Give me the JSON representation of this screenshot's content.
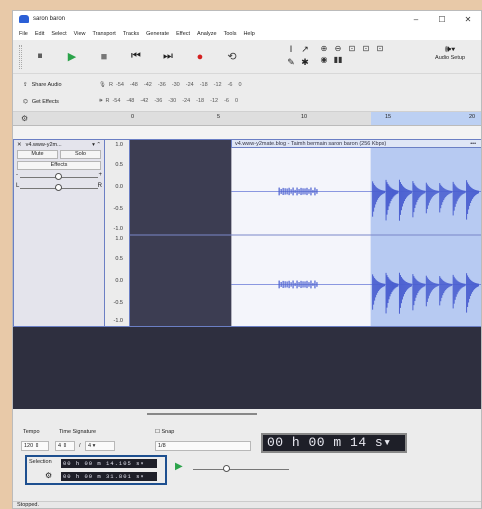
{
  "window": {
    "title": "saron baron",
    "minimize": "–",
    "maximize": "☐",
    "close": "✕"
  },
  "menu": [
    "File",
    "Edit",
    "Select",
    "View",
    "Transport",
    "Tracks",
    "Generate",
    "Effect",
    "Analyze",
    "Tools",
    "Help"
  ],
  "toolbar": {
    "pause": "⏸",
    "play": "▶",
    "stop": "■",
    "skip_start": "⏮",
    "skip_end": "⏭",
    "record": "●",
    "loop": "⟲",
    "audio_setup_label": "Audio Setup",
    "audio_setup_icon": "🕪▾"
  },
  "edit_tools": [
    "I",
    "↗",
    "✎",
    "✱"
  ],
  "zoom_tools": [
    "⊕",
    "⊖",
    "⊡",
    "⊡",
    "⊡",
    "◉",
    "▮▮",
    "",
    "",
    ""
  ],
  "row2": {
    "share_audio": "Share Audio",
    "get_effects": "Get Effects",
    "mic_meter_ticks": [
      "-54",
      "-48",
      "-42",
      "-36",
      "-30",
      "-24",
      "-18",
      "-12",
      "-6",
      "0"
    ],
    "play_meter_ticks": [
      "-54",
      "-48",
      "-42",
      "-36",
      "-30",
      "-24",
      "-18",
      "-12",
      "-6",
      "0"
    ],
    "mic_label": "R",
    "play_label": "R"
  },
  "ruler": {
    "ticks": [
      "0",
      "5",
      "10",
      "15",
      "20"
    ]
  },
  "track": {
    "name": "v4.www-y2m...",
    "mute": "Mute",
    "solo": "Solo",
    "effects": "Effects",
    "gain_minus": "-",
    "gain_plus": "+",
    "pan_left": "L",
    "pan_right": "R",
    "gain_level": 0.5,
    "pan_level": 0.5,
    "clip_title": "v4.www-y2mate.blog - Taimh bermain saron baron (256 Kbps)",
    "clip_menu": "•••",
    "scale_top": [
      "1.0",
      "0.5",
      "0.0",
      "-0.5",
      "-1.0"
    ],
    "scale_bottom": [
      "1.0",
      "0.5",
      "0.0",
      "-0.5",
      "-1.0"
    ]
  },
  "bottom": {
    "tempo_label": "Tempo",
    "tempo_value": "120",
    "time_sig_label": "Time Signature",
    "time_sig_num": "4",
    "time_sig_slash": "/",
    "time_sig_den": "4",
    "snap_label": "Snap",
    "snap_value": "1/8",
    "big_time": "00 h 00 m 14 s",
    "selection_label": "Selection",
    "selection_start": "00 h 00 m 14.105 s",
    "selection_end": "00 h 00 m 31.801 s",
    "play_at_speed": "▶"
  },
  "status": {
    "text": "Stopped."
  },
  "colors": {
    "waveform": "#4a5fd0",
    "selection": "#bcd0f3",
    "record": "#d42020",
    "play": "#2ba34a"
  }
}
